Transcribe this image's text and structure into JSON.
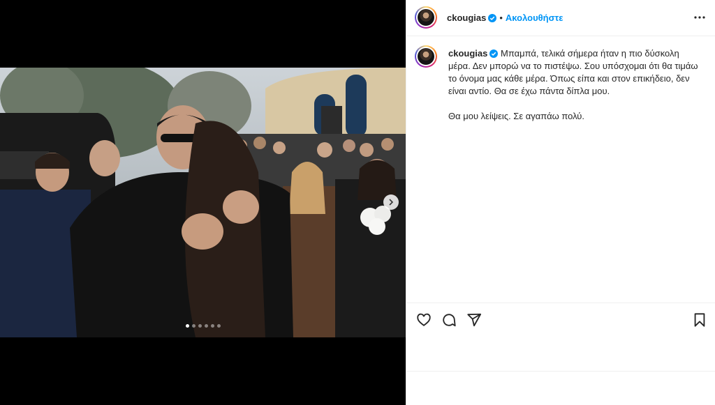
{
  "post": {
    "username": "ckougias",
    "follow_label": "Ακολουθήστε",
    "separator": "•",
    "caption_paragraph_1": "Μπαμπά, τελικά σήμερα ήταν η πιο δύσκολη μέρα. Δεν μπορώ να το πιστέψω. Σου υπόσχομαι ότι θα τιμάω το όνομα μας κάθε μέρα. Όπως είπα και στον επικήδειο, δεν είναι αντίο. Θα σε έχω πάντα δίπλα μου.",
    "caption_paragraph_2": "Θα μου λείψεις. Σε αγαπάω πολύ.",
    "carousel": {
      "total_slides": 6,
      "current_slide": 1
    }
  },
  "icons": {
    "verified": "verified-badge-icon",
    "more": "more-options-icon",
    "like": "heart-icon",
    "comment": "comment-icon",
    "share": "send-icon",
    "save": "bookmark-icon",
    "next": "chevron-right-icon"
  },
  "colors": {
    "accent": "#0095f6",
    "text": "#262626",
    "divider": "#efefef"
  }
}
